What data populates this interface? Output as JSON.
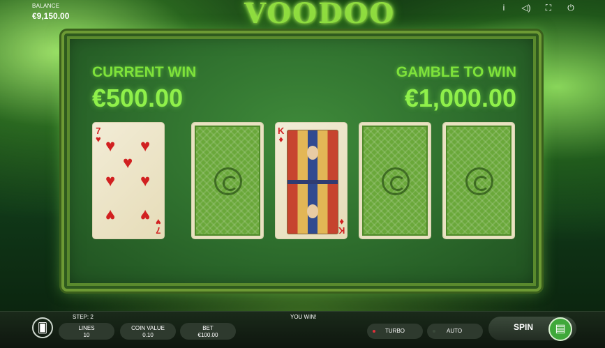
{
  "balance": {
    "label": "BALANCE",
    "value": "€9,150.00"
  },
  "logo": "VOODOO",
  "top_icons": [
    "info-icon",
    "sound-icon",
    "fullscreen-icon",
    "power-icon"
  ],
  "gamble": {
    "current_win_label": "CURRENT WIN",
    "current_win_value": "€500.00",
    "gamble_to_win_label": "GAMBLE TO WIN",
    "gamble_to_win_value": "€1,000.00",
    "cards": [
      {
        "state": "face",
        "rank": "7",
        "suit": "♥"
      },
      {
        "state": "back"
      },
      {
        "state": "face",
        "rank": "K",
        "suit": "♦"
      },
      {
        "state": "back"
      },
      {
        "state": "back"
      }
    ]
  },
  "footer": {
    "step": "STEP: 2",
    "status": "YOU WIN!",
    "lines_label": "LINES",
    "lines_value": "10",
    "coin_value_label": "COIN VALUE",
    "coin_value_value": "0.10",
    "bet_label": "BET",
    "bet_value": "€100.00",
    "turbo_label": "TURBO",
    "auto_label": "AUTO",
    "spin_label": "SPIN"
  },
  "colors": {
    "accent_green": "#8ff04a",
    "turbo_dot": "#e0303a",
    "auto_dot": "#3a4a3a"
  }
}
